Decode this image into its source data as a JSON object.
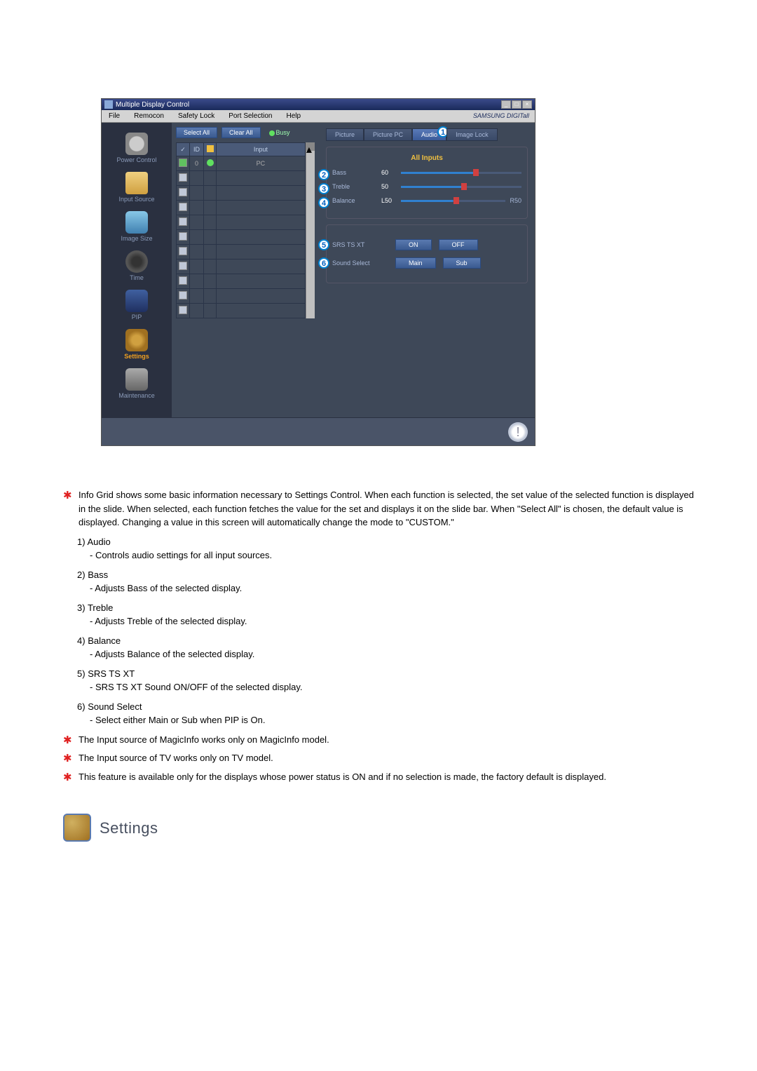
{
  "app": {
    "title": "Multiple Display Control",
    "brand": "SAMSUNG DIGITall"
  },
  "menu": [
    "File",
    "Remocon",
    "Safety Lock",
    "Port Selection",
    "Help"
  ],
  "sidebar": [
    {
      "label": "Power Control",
      "icon": "ic-power"
    },
    {
      "label": "Input Source",
      "icon": "ic-input"
    },
    {
      "label": "Image Size",
      "icon": "ic-image"
    },
    {
      "label": "Time",
      "icon": "ic-time"
    },
    {
      "label": "PIP",
      "icon": "ic-pip"
    },
    {
      "label": "Settings",
      "icon": "ic-settings",
      "active": true
    },
    {
      "label": "Maintenance",
      "icon": "ic-maint"
    }
  ],
  "list": {
    "select_all": "Select All",
    "clear_all": "Clear All",
    "busy": "Busy",
    "headers": {
      "chk": "✓",
      "id": "ID",
      "status": "",
      "input": "Input"
    },
    "rows": [
      {
        "checked": true,
        "id": "0",
        "dot": "on",
        "input": "PC"
      },
      {
        "checked": false
      },
      {
        "checked": false
      },
      {
        "checked": false
      },
      {
        "checked": false
      },
      {
        "checked": false
      },
      {
        "checked": false
      },
      {
        "checked": false
      },
      {
        "checked": false
      },
      {
        "checked": false
      },
      {
        "checked": false
      }
    ]
  },
  "tabs": [
    "Picture",
    "Picture PC",
    "Audio",
    "Image Lock"
  ],
  "active_tab_badge": "1",
  "panel": {
    "header": "All Inputs",
    "bass": {
      "label": "Bass",
      "value": "60",
      "badge": "2"
    },
    "treble": {
      "label": "Treble",
      "value": "50",
      "badge": "3"
    },
    "balance": {
      "label": "Balance",
      "left": "L50",
      "right": "R50",
      "badge": "4"
    },
    "srs": {
      "label": "SRS TS XT",
      "on": "ON",
      "off": "OFF",
      "badge": "5"
    },
    "sound_select": {
      "label": "Sound Select",
      "main": "Main",
      "sub": "Sub",
      "badge": "6"
    }
  },
  "doc": {
    "intro": "Info Grid shows some basic information necessary to Settings Control. When each function is selected, the set value of the selected function is displayed in the slide. When selected, each function fetches the value for the set and displays it on the slide bar. When \"Select All\" is chosen, the default value is displayed. Changing a value in this screen will automatically change the mode to \"CUSTOM.\"",
    "items": [
      {
        "num": "1)",
        "title": "Audio",
        "desc": "- Controls audio settings for all input sources."
      },
      {
        "num": "2)",
        "title": "Bass",
        "desc": "- Adjusts Bass of the selected display."
      },
      {
        "num": "3)",
        "title": "Treble",
        "desc": "- Adjusts Treble of the selected display."
      },
      {
        "num": "4)",
        "title": "Balance",
        "desc": "- Adjusts Balance of the selected display."
      },
      {
        "num": "5)",
        "title": "SRS TS XT",
        "desc": "- SRS TS XT Sound ON/OFF of the selected display."
      },
      {
        "num": "6)",
        "title": "Sound Select",
        "desc": "- Select either Main or Sub when PIP is On."
      }
    ],
    "note1": "The Input source of MagicInfo works only on MagicInfo model.",
    "note2": "The Input source of TV works only on TV model.",
    "note3": "This feature is available only for the displays whose power status is ON and if no selection is made, the factory default is displayed.",
    "section_title": "Settings"
  }
}
